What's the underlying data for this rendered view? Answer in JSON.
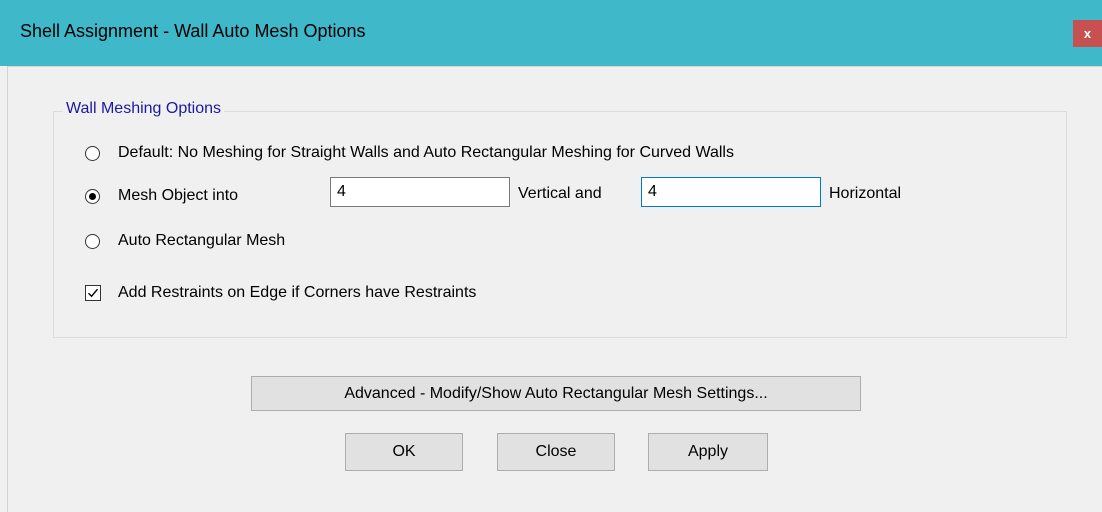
{
  "window": {
    "title": "Shell Assignment - Wall Auto Mesh Options",
    "close_label": "x"
  },
  "group": {
    "title": "Wall Meshing Options"
  },
  "options": {
    "default_label": "Default:  No Meshing for Straight Walls and Auto Rectangular Meshing for Curved Walls",
    "mesh_object_label": "Mesh Object into",
    "vertical_value": "4",
    "vertical_label": "Vertical  and",
    "horizontal_value": "4",
    "horizontal_label": "Horizontal",
    "auto_rect_label": "Auto Rectangular Mesh",
    "selected": "mesh_object"
  },
  "restraints": {
    "label": "Add Restraints on Edge if Corners have Restraints",
    "checked": true
  },
  "buttons": {
    "advanced": "Advanced - Modify/Show Auto Rectangular Mesh Settings...",
    "ok": "OK",
    "close": "Close",
    "apply": "Apply"
  },
  "colors": {
    "titlebar": "#3fb8c9",
    "close_button": "#c75050",
    "group_title": "#1a1aa0",
    "focus_border": "#0078d7"
  }
}
